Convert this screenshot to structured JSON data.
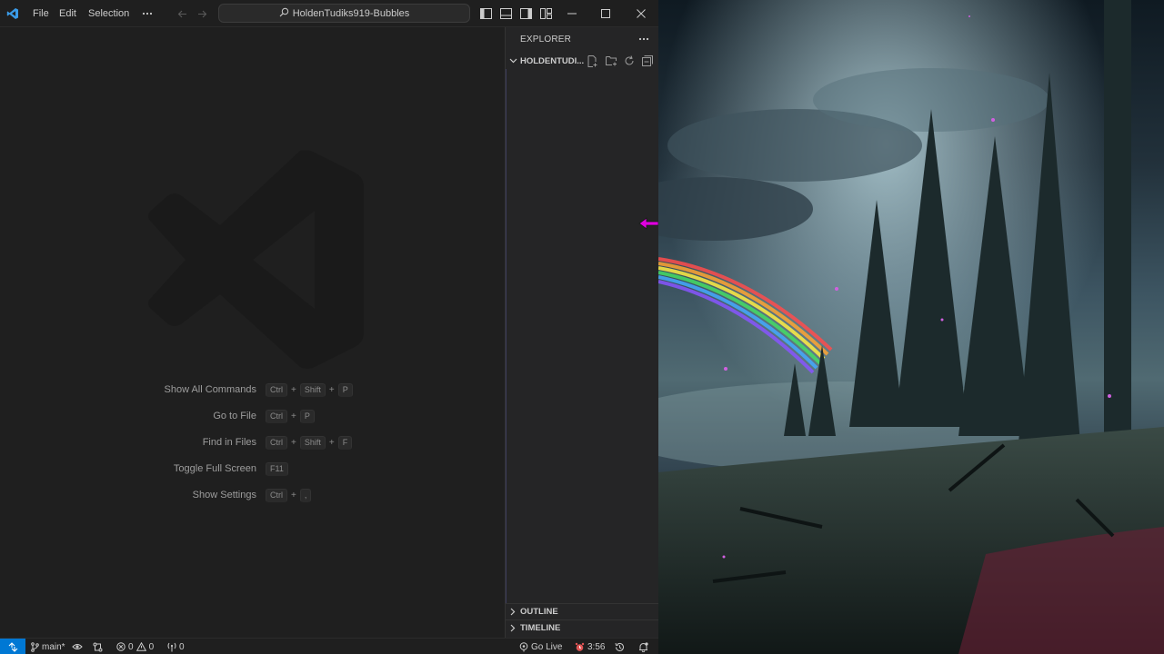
{
  "titlebar": {
    "app_icon": "vscode-logo-icon",
    "menu": [
      "File",
      "Edit",
      "Selection"
    ],
    "more_icon": "ellipsis-icon",
    "back_icon": "arrow-left-icon",
    "forward_icon": "arrow-right-icon",
    "search_text": "HoldenTudiks919-Bubbles",
    "search_icon": "search-icon",
    "layout_icons": [
      "toggle-primary-sidebar-icon",
      "toggle-panel-icon",
      "toggle-secondary-sidebar-icon",
      "customize-layout-icon"
    ],
    "window_controls": [
      "minimize-icon",
      "maximize-icon",
      "close-icon"
    ]
  },
  "editor": {
    "shortcuts": [
      {
        "label": "Show All Commands",
        "keys": [
          "Ctrl",
          "Shift",
          "P"
        ]
      },
      {
        "label": "Go to File",
        "keys": [
          "Ctrl",
          "P"
        ]
      },
      {
        "label": "Find in Files",
        "keys": [
          "Ctrl",
          "Shift",
          "F"
        ]
      },
      {
        "label": "Toggle Full Screen",
        "keys": [
          "F11"
        ]
      },
      {
        "label": "Show Settings",
        "keys": [
          "Ctrl",
          ","
        ]
      }
    ]
  },
  "sidebar": {
    "title": "EXPLORER",
    "more_icon": "ellipsis-icon",
    "folder": "HOLDENTUDI...",
    "folder_actions": [
      "new-file-icon",
      "new-folder-icon",
      "refresh-icon",
      "collapse-all-icon"
    ],
    "sections": [
      "OUTLINE",
      "TIMELINE"
    ]
  },
  "statusbar": {
    "remote_icon": "remote-icon",
    "branch": "main*",
    "sync_icon": "sync-icon",
    "extensions_icon": "git-compare-icon",
    "errors": "0",
    "warnings": "0",
    "ports": "0",
    "go_live": "Go Live",
    "timer": "3:56",
    "history_icon": "history-icon",
    "notifications_icon": "bell-icon"
  },
  "colors": {
    "editor_bg": "#1f1f1f",
    "sidebar_bg": "#252526",
    "remote_accent": "#0078d4",
    "timer_icon": "#e05555",
    "cursor": "#e000e0"
  }
}
